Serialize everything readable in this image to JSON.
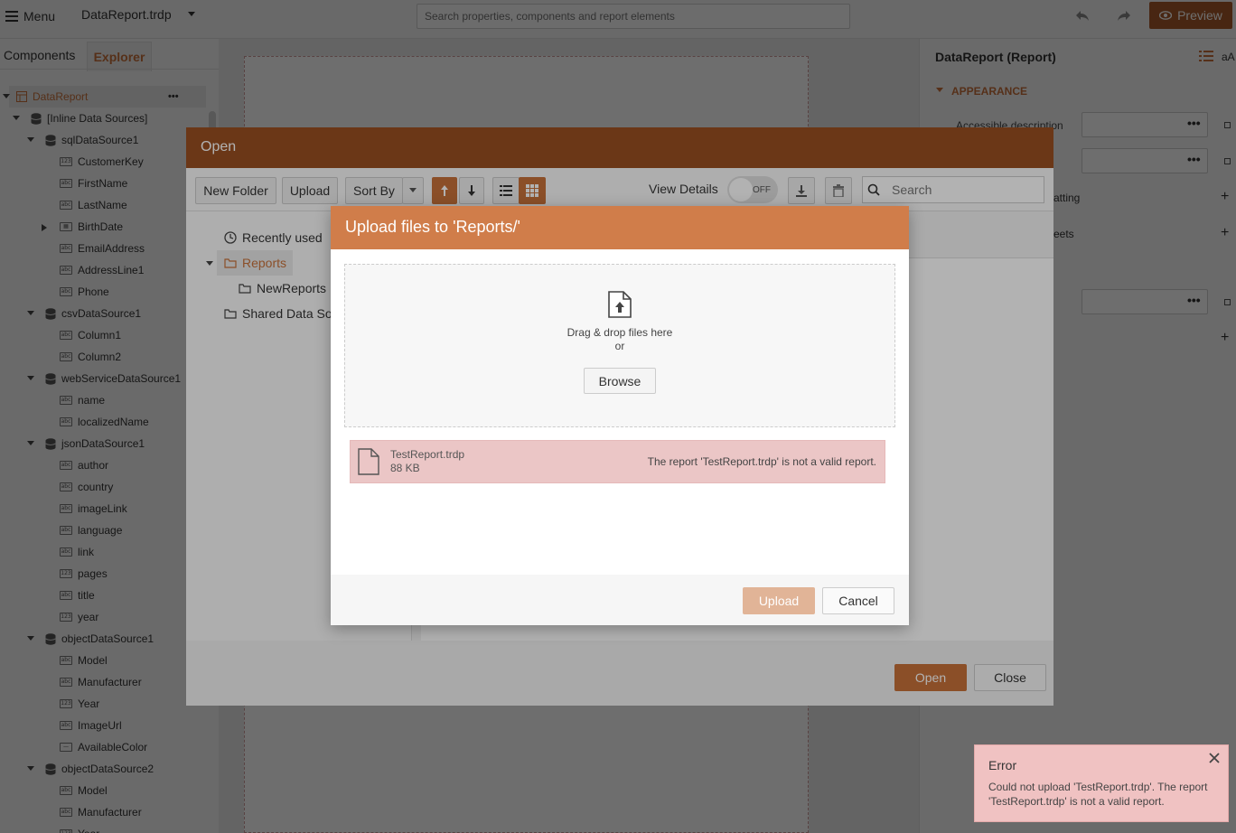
{
  "topbar": {
    "menu_label": "Menu",
    "doc_title": "DataReport.trdp",
    "search_placeholder": "Search properties, components and report elements",
    "preview_label": "Preview"
  },
  "left_panel": {
    "tabs": [
      "Components",
      "Explorer"
    ],
    "tree": [
      {
        "label": "DataReport",
        "level": 0,
        "kind": "report",
        "expanded": true,
        "selected": true
      },
      {
        "label": "[Inline Data Sources]",
        "level": 1,
        "kind": "db",
        "expanded": true
      },
      {
        "label": "sqlDataSource1",
        "level": 2,
        "kind": "db",
        "expanded": true
      },
      {
        "label": "CustomerKey",
        "level": 3,
        "kind": "num"
      },
      {
        "label": "FirstName",
        "level": 3,
        "kind": "abc"
      },
      {
        "label": "LastName",
        "level": 3,
        "kind": "abc"
      },
      {
        "label": "BirthDate",
        "level": 3,
        "kind": "date",
        "collapsed": true
      },
      {
        "label": "EmailAddress",
        "level": 3,
        "kind": "abc"
      },
      {
        "label": "AddressLine1",
        "level": 3,
        "kind": "abc"
      },
      {
        "label": "Phone",
        "level": 3,
        "kind": "abc"
      },
      {
        "label": "csvDataSource1",
        "level": 2,
        "kind": "db",
        "expanded": true
      },
      {
        "label": "Column1",
        "level": 3,
        "kind": "abc"
      },
      {
        "label": "Column2",
        "level": 3,
        "kind": "abc"
      },
      {
        "label": "webServiceDataSource1",
        "level": 2,
        "kind": "db",
        "expanded": true
      },
      {
        "label": "name",
        "level": 3,
        "kind": "abc"
      },
      {
        "label": "localizedName",
        "level": 3,
        "kind": "abc"
      },
      {
        "label": "jsonDataSource1",
        "level": 2,
        "kind": "db",
        "expanded": true
      },
      {
        "label": "author",
        "level": 3,
        "kind": "abc"
      },
      {
        "label": "country",
        "level": 3,
        "kind": "abc"
      },
      {
        "label": "imageLink",
        "level": 3,
        "kind": "abc"
      },
      {
        "label": "language",
        "level": 3,
        "kind": "abc"
      },
      {
        "label": "link",
        "level": 3,
        "kind": "abc"
      },
      {
        "label": "pages",
        "level": 3,
        "kind": "num"
      },
      {
        "label": "title",
        "level": 3,
        "kind": "abc"
      },
      {
        "label": "year",
        "level": 3,
        "kind": "num"
      },
      {
        "label": "objectDataSource1",
        "level": 2,
        "kind": "db",
        "expanded": true
      },
      {
        "label": "Model",
        "level": 3,
        "kind": "abc"
      },
      {
        "label": "Manufacturer",
        "level": 3,
        "kind": "abc"
      },
      {
        "label": "Year",
        "level": 3,
        "kind": "num"
      },
      {
        "label": "ImageUrl",
        "level": 3,
        "kind": "abc"
      },
      {
        "label": "AvailableColor",
        "level": 3,
        "kind": "obj"
      },
      {
        "label": "objectDataSource2",
        "level": 2,
        "kind": "db",
        "expanded": true
      },
      {
        "label": "Model",
        "level": 3,
        "kind": "abc"
      },
      {
        "label": "Manufacturer",
        "level": 3,
        "kind": "abc"
      },
      {
        "label": "Year",
        "level": 3,
        "kind": "num"
      }
    ]
  },
  "right_panel": {
    "title": "DataReport (Report)",
    "font_size_label": "aA",
    "section_appearance": "APPEARANCE",
    "accessible_description": "Accessible description",
    "partial_formatting": "atting",
    "partial_sheets": "eets"
  },
  "open_dialog": {
    "title": "Open",
    "toolbar": {
      "new_folder": "New Folder",
      "upload": "Upload",
      "sort_by": "Sort By",
      "view_details": "View Details",
      "toggle_state": "OFF",
      "search_placeholder": "Search"
    },
    "tree": {
      "recently_used": "Recently used",
      "reports": "Reports",
      "new_reports": "NewReports",
      "shared": "Shared Data Sou"
    },
    "open_label": "Open",
    "close_label": "Close"
  },
  "upload_dialog": {
    "title": "Upload files to 'Reports/'",
    "drop_text": "Drag & drop files here",
    "or_text": "or",
    "browse_label": "Browse",
    "file": {
      "name": "TestReport.trdp",
      "size": "88 KB",
      "error": "The report 'TestReport.trdp' is not a valid report."
    },
    "upload_label": "Upload",
    "cancel_label": "Cancel"
  },
  "toast": {
    "title": "Error",
    "message": "Could not upload 'TestReport.trdp'. The report 'TestReport.trdp' is not a valid report."
  },
  "colors": {
    "accent": "#c8713a",
    "header_dark": "#9a4f22",
    "upload_header": "#d07d4a",
    "error_bg": "#f0c2c2"
  }
}
